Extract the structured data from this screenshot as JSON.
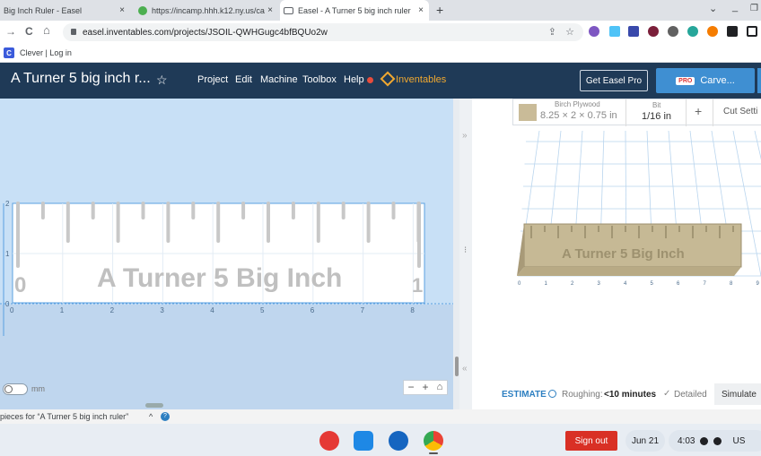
{
  "tabs": [
    {
      "title": "Big Inch Ruler - Easel",
      "close": "×"
    },
    {
      "title": "https://incamp.hhh.k12.ny.us/ca",
      "close": "×"
    },
    {
      "title": "Easel - A Turner 5 big inch ruler",
      "close": "×"
    }
  ],
  "new_tab": "+",
  "window_controls": {
    "collapse": "⌄",
    "minimize": "_",
    "restore": "❐"
  },
  "nav": {
    "back": "→",
    "reload": "C",
    "home": "⌂"
  },
  "address": {
    "url": "easel.inventables.com/projects/JSOIL-QWHGugc4bfBQUo2w"
  },
  "bookmarks": [
    {
      "icon_letter": "C",
      "label": "Clever | Log in"
    }
  ],
  "header": {
    "project_title": "A Turner 5 big inch r...",
    "star": "☆",
    "menu": [
      "Project",
      "Edit",
      "Machine",
      "Toolbox",
      "Help"
    ],
    "brand": "Inventables",
    "get_pro": "Get Easel Pro",
    "pro_badge": "PRO",
    "carve": "Carve..."
  },
  "material": {
    "name": "Birch Plywood",
    "dimensions": "8.25 × 2 × 0.75 in",
    "bit_label": "Bit",
    "bit_value": "1/16 in",
    "add": "+",
    "cut_settings": "Cut Setti"
  },
  "ruler": {
    "text": "A Turner 5 Big Inch",
    "left_mark": "0",
    "right_mark": "1",
    "x_ticks": [
      "0",
      "1",
      "2",
      "3",
      "4",
      "5",
      "6",
      "7",
      "8"
    ],
    "y_ticks": [
      "2",
      "1",
      "0"
    ]
  },
  "preview3d": {
    "text": "A Turner 5 Big Inch",
    "x_ticks": [
      "0",
      "1",
      "2",
      "3",
      "4",
      "5",
      "6",
      "7",
      "8",
      "9"
    ]
  },
  "canvas_controls": {
    "unit_label": "mm",
    "zoom_out": "−",
    "zoom_in": "+",
    "home": "⌂"
  },
  "collapse_arrows": {
    "right": "»",
    "left": "«",
    "handle": "⁝"
  },
  "estimate": {
    "label": "ESTIMATE",
    "roughing_label": "Roughing:",
    "roughing_value": "<10 minutes",
    "detailed": "Detailed",
    "simulate": "Simulate"
  },
  "bottom_info": {
    "text": "pieces for “A Turner 5 big inch ruler”",
    "chevron": "^",
    "help": "?"
  },
  "shelf": {
    "sign_out": "Sign out",
    "date": "Jun 21",
    "time": "4:03",
    "locale": "US"
  },
  "colors": {
    "header_bg": "#1f3a57",
    "canvas_bg": "#c8e0f6",
    "carve_blue": "#3f8fd2",
    "signout_red": "#d93025",
    "wood": "#c9bb98",
    "estimate_blue": "#2d7fc1"
  }
}
